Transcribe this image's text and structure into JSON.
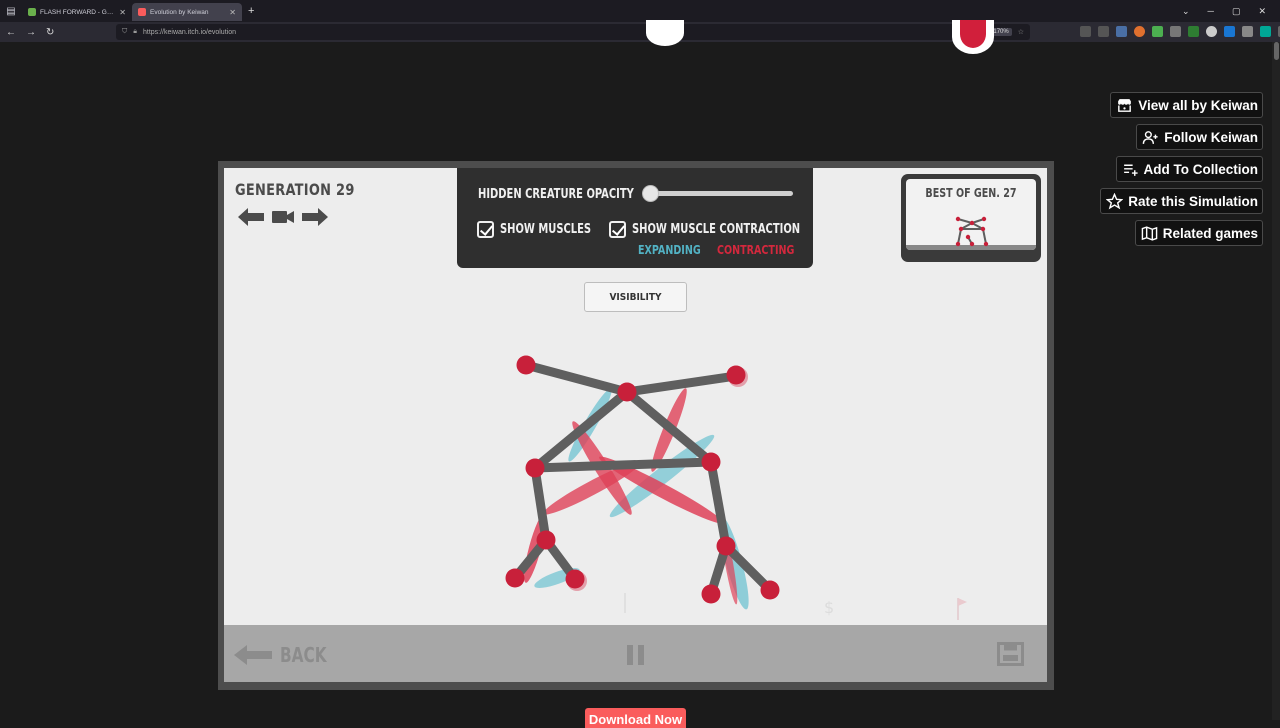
{
  "browser": {
    "tabs": [
      {
        "title": "FLASH FORWARD - Google Dri",
        "active": false
      },
      {
        "title": "Evolution by Keiwan",
        "active": true
      }
    ],
    "url": "https://keiwan.itch.io/evolution",
    "zoom": "170%"
  },
  "sidebar": {
    "buttons": [
      {
        "label": "View all by Keiwan",
        "icon": "itch-icon"
      },
      {
        "label": "Follow Keiwan",
        "icon": "user-plus-icon"
      },
      {
        "label": "Add To Collection",
        "icon": "playlist-add-icon"
      },
      {
        "label": "Rate this Simulation",
        "icon": "star-icon"
      },
      {
        "label": "Related games",
        "icon": "map-icon"
      }
    ]
  },
  "game": {
    "generation_title": "GENERATION 29",
    "opacity_panel": {
      "title": "HIDDEN CREATURE OPACITY",
      "slider_value": 0.0,
      "show_muscles": {
        "label": "SHOW MUSCLES",
        "checked": true
      },
      "show_contraction": {
        "label": "SHOW MUSCLE CONTRACTION",
        "checked": true
      },
      "legend_expanding": "EXPANDING",
      "legend_contracting": "CONTRACTING"
    },
    "best_of": "BEST OF GEN. 27",
    "visibility_button": "VISIBILITY",
    "back_label": "BACK",
    "colors": {
      "joint": "#c8203a",
      "bone": "#5f5f5f",
      "expanding": "#7cc7d3",
      "contracting": "#de4158"
    }
  },
  "page": {
    "download_label": "Download Now"
  }
}
